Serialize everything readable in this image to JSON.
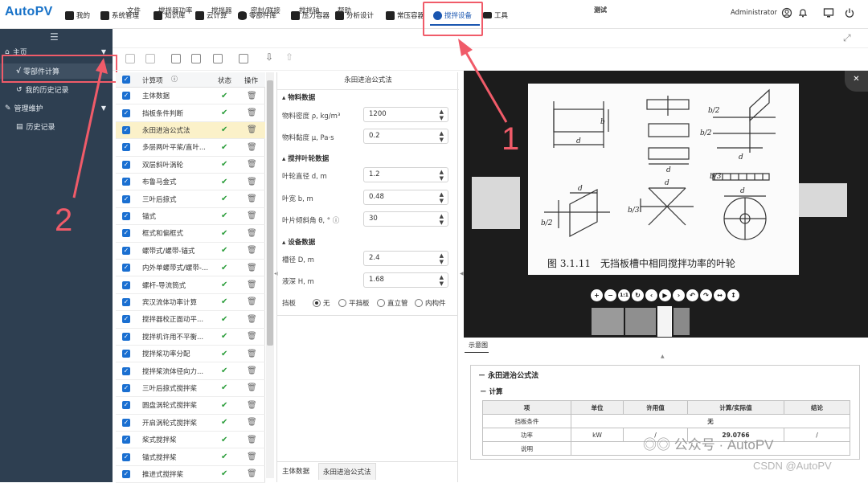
{
  "app": {
    "logo": "AutoPV",
    "title": "测试"
  },
  "topnav": [
    {
      "label": "我的"
    },
    {
      "label": "系统管理"
    },
    {
      "label": "知识库"
    },
    {
      "label": "云计算"
    },
    {
      "label": "零部件库"
    },
    {
      "label": "压力容器"
    },
    {
      "label": "分析设计"
    },
    {
      "label": "常压容器"
    },
    {
      "label": "搅拌设备",
      "active": true
    },
    {
      "label": "工具"
    }
  ],
  "user": {
    "name": "Administrator"
  },
  "sidebar": {
    "items": [
      {
        "label": "主页",
        "icon": "home-icon"
      },
      {
        "label": "零部件计算",
        "icon": "sqrt-icon"
      },
      {
        "label": "我的历史记录",
        "icon": "history-icon"
      },
      {
        "label": "管理维护",
        "icon": "wrench-icon"
      },
      {
        "label": "历史记录",
        "icon": "list-icon"
      }
    ]
  },
  "menubar": [
    "文件",
    "搅拌器功率",
    "搅拌器",
    "密封/联接",
    "搅拌轴",
    "帮助"
  ],
  "calc_list": {
    "headers": {
      "item": "计算项",
      "status": "状态",
      "action": "操作"
    },
    "rows": [
      "主体数据",
      "挡板条件判断",
      "永田进治公式法",
      "多层两叶平桨/直叶...",
      "双层斜叶涡轮",
      "布鲁马金式",
      "三叶后掠式",
      "锚式",
      "框式和偏框式",
      "螺带式/螺带-锚式",
      "内外单螺带式/螺带-...",
      "螺杆-导流筒式",
      "宾汉流体功率计算",
      "搅拌器校正面动平...",
      "搅拌机许用不平衡...",
      "搅拌桨功率分配",
      "搅拌桨流体径向力...",
      "三叶后掠式搅拌桨",
      "圆盘涡轮式搅拌桨",
      "开启涡轮式搅拌桨",
      "桨式搅拌桨",
      "锚式搅拌桨",
      "推进式搅拌桨"
    ],
    "selected_index": 2
  },
  "form": {
    "title": "永田进治公式法",
    "sections": [
      {
        "title": "物料数据",
        "fields": [
          {
            "label": "物料密度 ρ, kg/m³",
            "value": "1200"
          },
          {
            "label": "物料黏度 μ, Pa·s",
            "value": "0.2"
          }
        ]
      },
      {
        "title": "搅拌叶轮数据",
        "fields": [
          {
            "label": "叶轮直径 d, m",
            "value": "1.2"
          },
          {
            "label": "叶宽 b, m",
            "value": "0.48"
          },
          {
            "label": "叶片倾斜角 θ, °",
            "value": "30"
          }
        ]
      },
      {
        "title": "设备数据",
        "fields": [
          {
            "label": "槽径 D, m",
            "value": "2.4"
          },
          {
            "label": "液深 H, m",
            "value": "1.68"
          }
        ]
      }
    ],
    "baffle": {
      "label": "挡板",
      "options": [
        "无",
        "平挡板",
        "直立管",
        "内构件"
      ],
      "selected": "无"
    },
    "bottom_tabs": [
      "主体数据",
      "永田进治公式法"
    ]
  },
  "viewer": {
    "caption": "图 3.1.11　无挡板槽中相同搅拌功率的叶轮",
    "labels": {
      "d": "d",
      "b": "b",
      "b2": "b/2",
      "b3": "b/3"
    },
    "zoom_label": "1:1",
    "tab": "示意图"
  },
  "results": {
    "title": "永田进治公式法",
    "subtitle": "计算",
    "headers": [
      "项",
      "单位",
      "许用值",
      "计算/实际值",
      "结论"
    ],
    "rows": [
      [
        "挡板条件",
        "",
        "",
        "无",
        ""
      ],
      [
        "功率",
        "kW",
        "/",
        "29.0766",
        "/"
      ],
      [
        "说明",
        "",
        "",
        "",
        ""
      ]
    ]
  },
  "annotations": {
    "one": "1",
    "two": "2"
  },
  "watermark": {
    "wechat": "公众号 · AutoPV",
    "csdn": "CSDN @AutoPV"
  },
  "colors": {
    "brand": "#1a73c8",
    "active": "#1a56b0",
    "sidebar": "#2e3f51",
    "annotation": "#f05b69",
    "check": "#2a9d3a"
  }
}
